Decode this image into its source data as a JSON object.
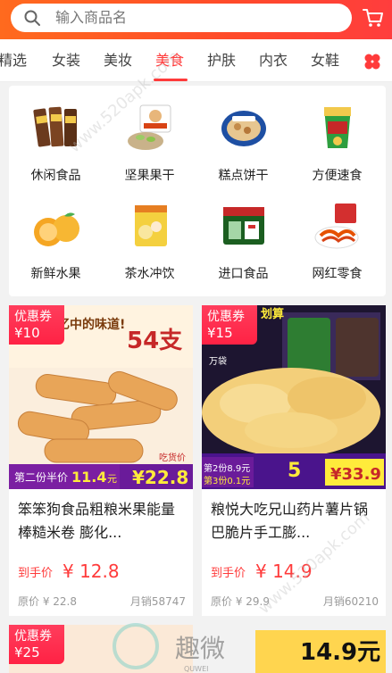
{
  "search": {
    "placeholder": "输入商品名"
  },
  "tabs": [
    {
      "label": "精选"
    },
    {
      "label": "女装"
    },
    {
      "label": "美妆"
    },
    {
      "label": "美食"
    },
    {
      "label": "护肤"
    },
    {
      "label": "内衣"
    },
    {
      "label": "女鞋"
    }
  ],
  "active_tab": "美食",
  "categories": [
    {
      "label": "休闲食品",
      "icon": "snack-icon"
    },
    {
      "label": "坚果果干",
      "icon": "nuts-icon"
    },
    {
      "label": "糕点饼干",
      "icon": "cookie-icon"
    },
    {
      "label": "方便速食",
      "icon": "instant-noodle-icon"
    },
    {
      "label": "新鲜水果",
      "icon": "orange-icon"
    },
    {
      "label": "茶水冲饮",
      "icon": "tea-icon"
    },
    {
      "label": "进口食品",
      "icon": "imported-food-icon"
    },
    {
      "label": "网红零食",
      "icon": "hot-snack-icon"
    }
  ],
  "products": [
    {
      "coupon_label": "优惠券",
      "coupon_value": "¥10",
      "title": "笨笨狗食品粗粮米果能量棒糙米卷 膨化...",
      "price_label": "到手价",
      "price": "¥ 12.8",
      "original_price": "原价 ¥ 22.8",
      "sales": "月销58747",
      "banner": {
        "headline": "54支",
        "slogan": "记忆中的味道!",
        "tag1": "第二份半价",
        "price_small": "11.4",
        "price_small_unit": "元",
        "price_big": "¥22.8",
        "promo_word": "吃货价"
      }
    },
    {
      "coupon_label": "优惠券",
      "coupon_value": "¥15",
      "title": "粮悦大吃兄山药片薯片锅巴脆片手工膨...",
      "price_label": "到手价",
      "price": "¥ 14.9",
      "original_price": "原价 ¥ 29.9",
      "sales": "月销60210",
      "banner": {
        "badge": "划算",
        "bag": "万袋",
        "tag1": "第2份8.9元",
        "tag2": "第3份0.1元",
        "count": "5",
        "price_big": "¥33.9"
      }
    },
    {
      "coupon_label": "优惠券",
      "coupon_value": "¥25"
    },
    {
      "banner_price": "14.9元"
    }
  ],
  "watermarks": [
    "www.520apk.com",
    "趣微",
    "QUWEI"
  ],
  "colors": {
    "accent": "#ff3b3b",
    "header_from": "#ff6a1e",
    "header_to": "#ff3d3d"
  }
}
